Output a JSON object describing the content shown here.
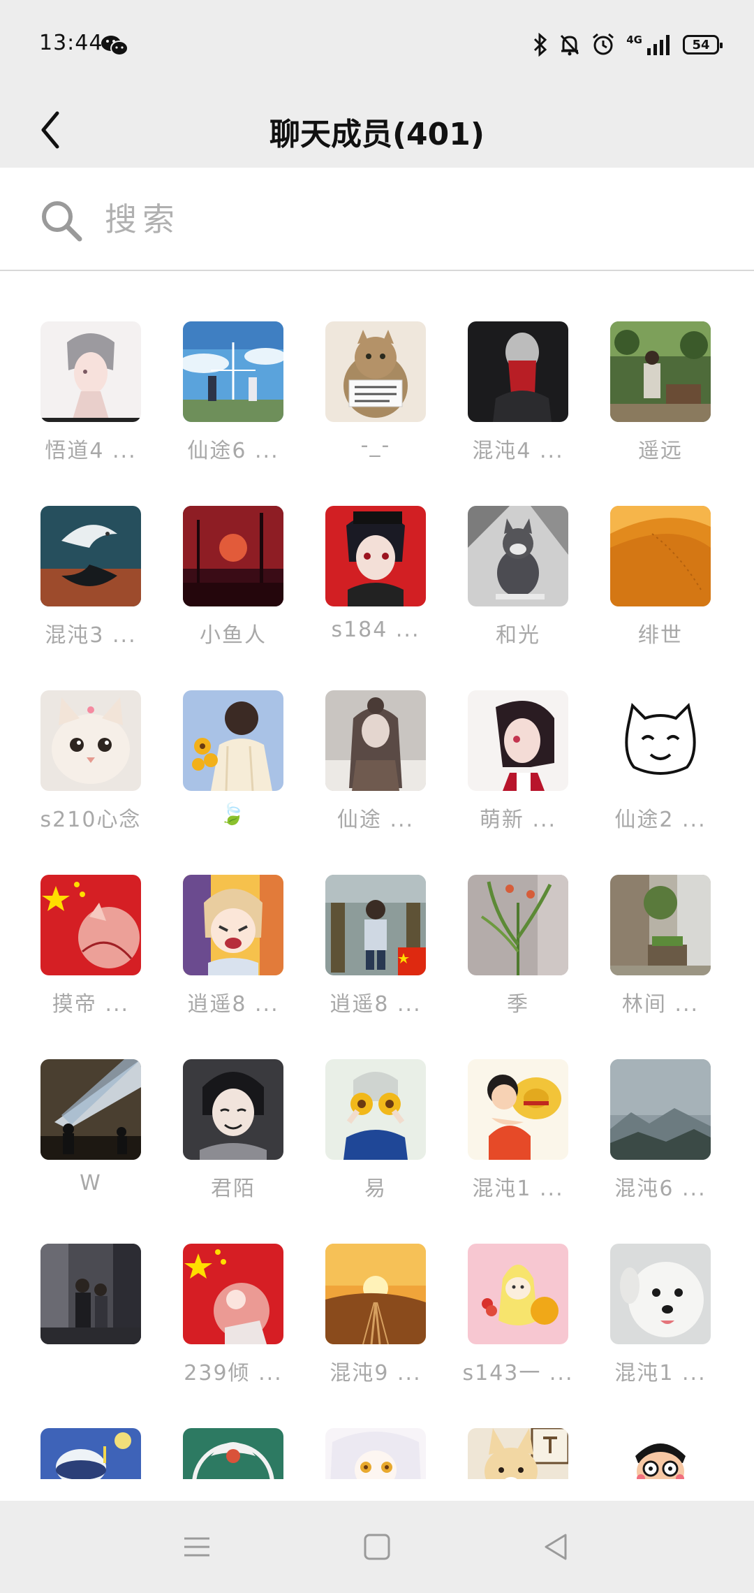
{
  "status_bar": {
    "time": "13:44",
    "network": "4G",
    "battery": "54",
    "icons": [
      "wechat-icon",
      "bluetooth-icon",
      "bell-off-icon",
      "alarm-icon",
      "signal-icon",
      "battery-icon"
    ]
  },
  "header": {
    "title": "聊天成员(401)",
    "back_icon": "chevron-left-icon"
  },
  "search": {
    "placeholder": "搜索",
    "icon": "search-icon"
  },
  "members": [
    {
      "name": "悟道4 ...",
      "avatar": "anime-boy-silver-hair"
    },
    {
      "name": "仙途6 ...",
      "avatar": "anime-couple-sky"
    },
    {
      "name": "-_-",
      "avatar": "cat-holding-sign"
    },
    {
      "name": "混沌4 ...",
      "avatar": "dark-figure-red-mask"
    },
    {
      "name": "遥远",
      "avatar": "garden-person"
    },
    {
      "name": "混沌3 ...",
      "avatar": "koi-fish-yin-yang"
    },
    {
      "name": "小鱼人",
      "avatar": "red-forest-moon"
    },
    {
      "name": "s184 ...",
      "avatar": "anime-boy-red-background"
    },
    {
      "name": "和光",
      "avatar": "cartoon-cat-sitting"
    },
    {
      "name": "绯世",
      "avatar": "desert-dune"
    },
    {
      "name": "s210心念",
      "avatar": "white-kitten"
    },
    {
      "name": "🍃",
      "avatar": "boy-holding-sunflowers"
    },
    {
      "name": "仙途 ...",
      "avatar": "anime-girl-snow"
    },
    {
      "name": "萌新 ...",
      "avatar": "anime-girl-bob-hair"
    },
    {
      "name": "仙途2 ...",
      "avatar": "cat-doodle"
    },
    {
      "name": "摸帝 ...",
      "avatar": "china-flag-fox"
    },
    {
      "name": "逍遥8 ...",
      "avatar": "anime-crying-girl"
    },
    {
      "name": "逍遥8 ...",
      "avatar": "child-with-flag"
    },
    {
      "name": "季",
      "avatar": "green-plant-vase"
    },
    {
      "name": "林间 ...",
      "avatar": "courtyard-garden"
    },
    {
      "name": "W",
      "avatar": "light-beam-silhouettes"
    },
    {
      "name": "君陌",
      "avatar": "anime-boy-dark-hair"
    },
    {
      "name": "易",
      "avatar": "sunflower-eyes-drawing"
    },
    {
      "name": "混沌1 ...",
      "avatar": "pirate-straw-hat"
    },
    {
      "name": "混沌6 ...",
      "avatar": "misty-mountains"
    },
    {
      "name": "",
      "avatar": "street-group-photo"
    },
    {
      "name": "239倾 ...",
      "avatar": "china-flag-character"
    },
    {
      "name": "混沌9 ...",
      "avatar": "sunset-railway"
    },
    {
      "name": "s143一 ...",
      "avatar": "banana-character"
    },
    {
      "name": "混沌1 ...",
      "avatar": "white-dog-waving"
    },
    {
      "name": "",
      "avatar": "blue-cartoon-dog"
    },
    {
      "name": "",
      "avatar": "green-circle-emblem"
    },
    {
      "name": "",
      "avatar": "white-hair-anime"
    },
    {
      "name": "",
      "avatar": "shiba-dog-sign"
    },
    {
      "name": "",
      "avatar": "cartoon-face-glasses"
    }
  ],
  "nav_bar": {
    "icons": [
      "menu-icon",
      "home-square-icon",
      "back-triangle-icon"
    ]
  }
}
